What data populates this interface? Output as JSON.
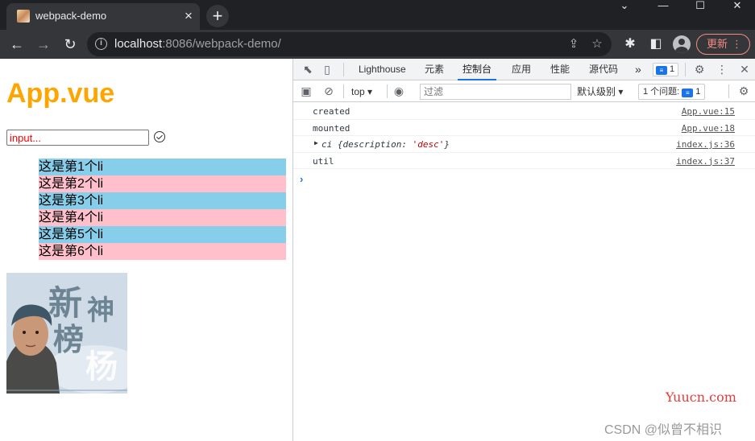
{
  "browser": {
    "tab_title": "webpack-demo",
    "url_host": "localhost",
    "url_rest": ":8086/webpack-demo/",
    "update_label": "更新"
  },
  "page": {
    "heading": "App.vue",
    "input_value": "input...",
    "list_items": [
      "这是第1个li",
      "这是第2个li",
      "这是第3个li",
      "这是第4个li",
      "这是第5个li",
      "这是第6个li"
    ],
    "poster_text": [
      "新",
      "神",
      "榜",
      "杨"
    ]
  },
  "devtools": {
    "tabs": [
      "Lighthouse",
      "元素",
      "控制台",
      "应用",
      "性能",
      "源代码"
    ],
    "active_tab": "控制台",
    "more_label": "»",
    "issue_badge": "1",
    "context": "top",
    "filter_placeholder": "过滤",
    "level": "默认级别",
    "issues_label": "1 个问题:",
    "issues_count": "1",
    "console": [
      {
        "msg": "created",
        "source": "App.vue:15"
      },
      {
        "msg": "mounted",
        "source": "App.vue:18"
      },
      {
        "msg_obj_name": "ci",
        "msg_obj_open": "{description: ",
        "msg_obj_str": "'desc'",
        "msg_obj_close": "}",
        "source": "index.js:36"
      },
      {
        "msg": "util",
        "source": "index.js:37"
      }
    ],
    "prompt_glyph": "›"
  },
  "watermarks": {
    "site": "Yuucn.com",
    "author": "CSDN @似曾不相识"
  },
  "icons": [
    "favicon-icon",
    "close-icon",
    "plus-icon",
    "back-icon",
    "forward-icon",
    "reload-icon",
    "info-icon",
    "share-icon",
    "star-icon",
    "extensions-icon",
    "sidepanel-icon",
    "avatar-icon",
    "inspect-icon",
    "device-icon",
    "settings-icon",
    "kebab-icon",
    "clear-icon",
    "eye-icon",
    "check-circle-icon"
  ]
}
